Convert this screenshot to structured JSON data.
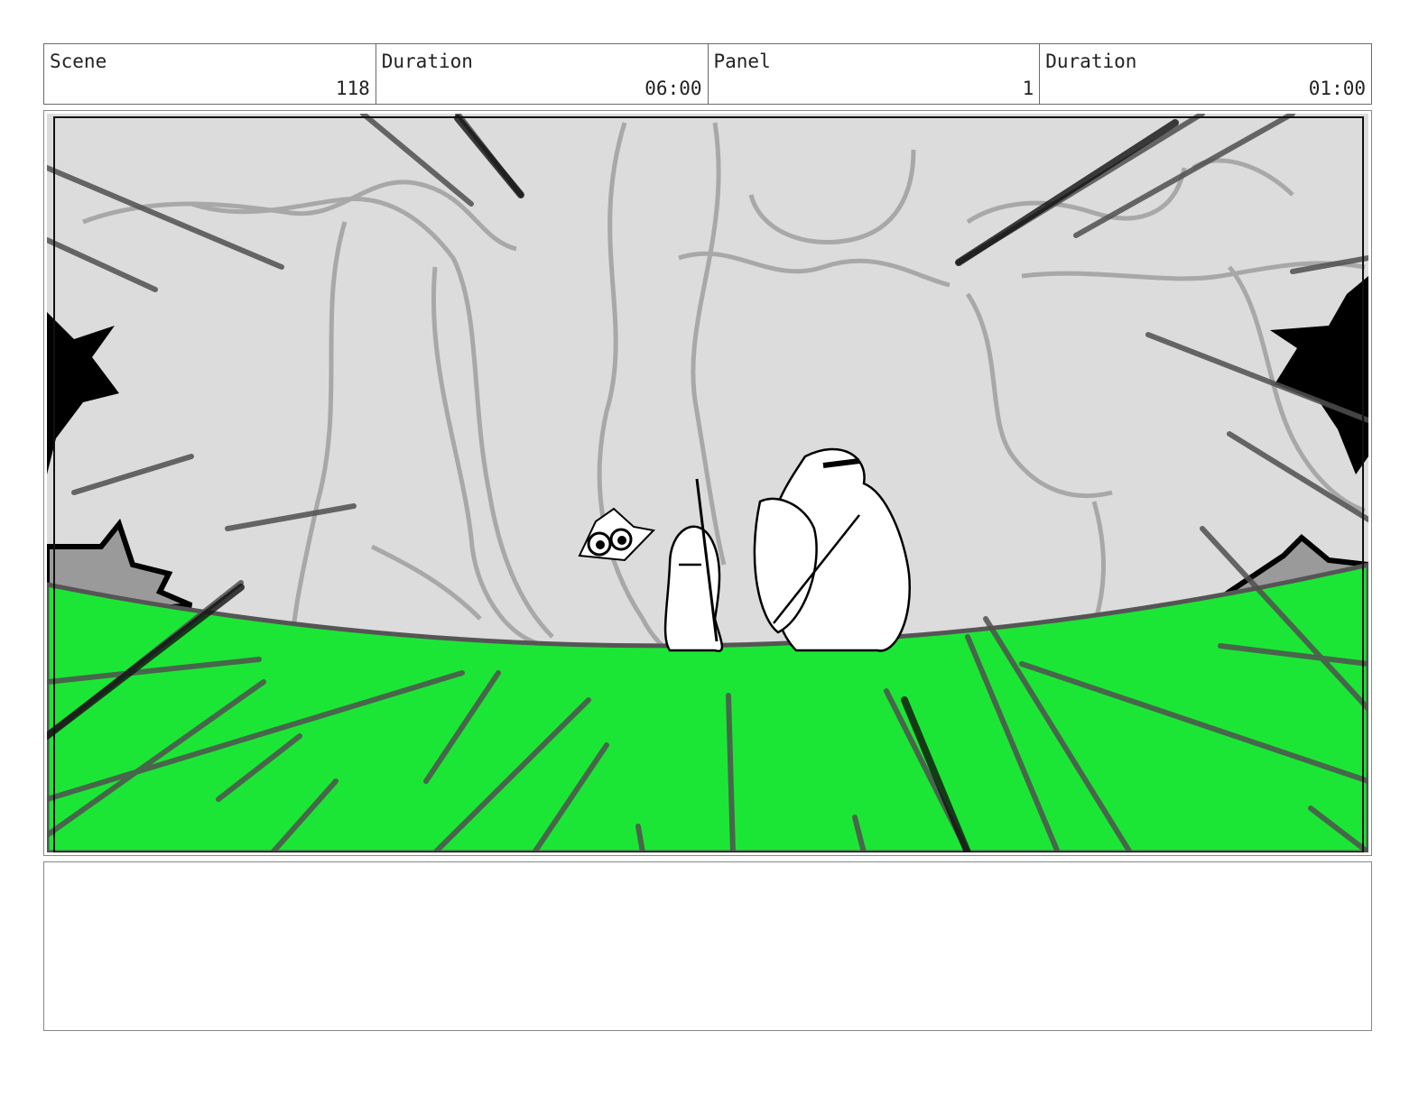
{
  "header": {
    "scene_label": "Scene",
    "scene_value": "118",
    "scene_duration_label": "Duration",
    "scene_duration_value": "06:00",
    "panel_label": "Panel",
    "panel_value": "1",
    "panel_duration_label": "Duration",
    "panel_duration_value": "01:00"
  },
  "colors": {
    "ground": "#1ce635",
    "sky": "#dcdcdc",
    "line": "#000000"
  },
  "notes": {
    "text": ""
  }
}
